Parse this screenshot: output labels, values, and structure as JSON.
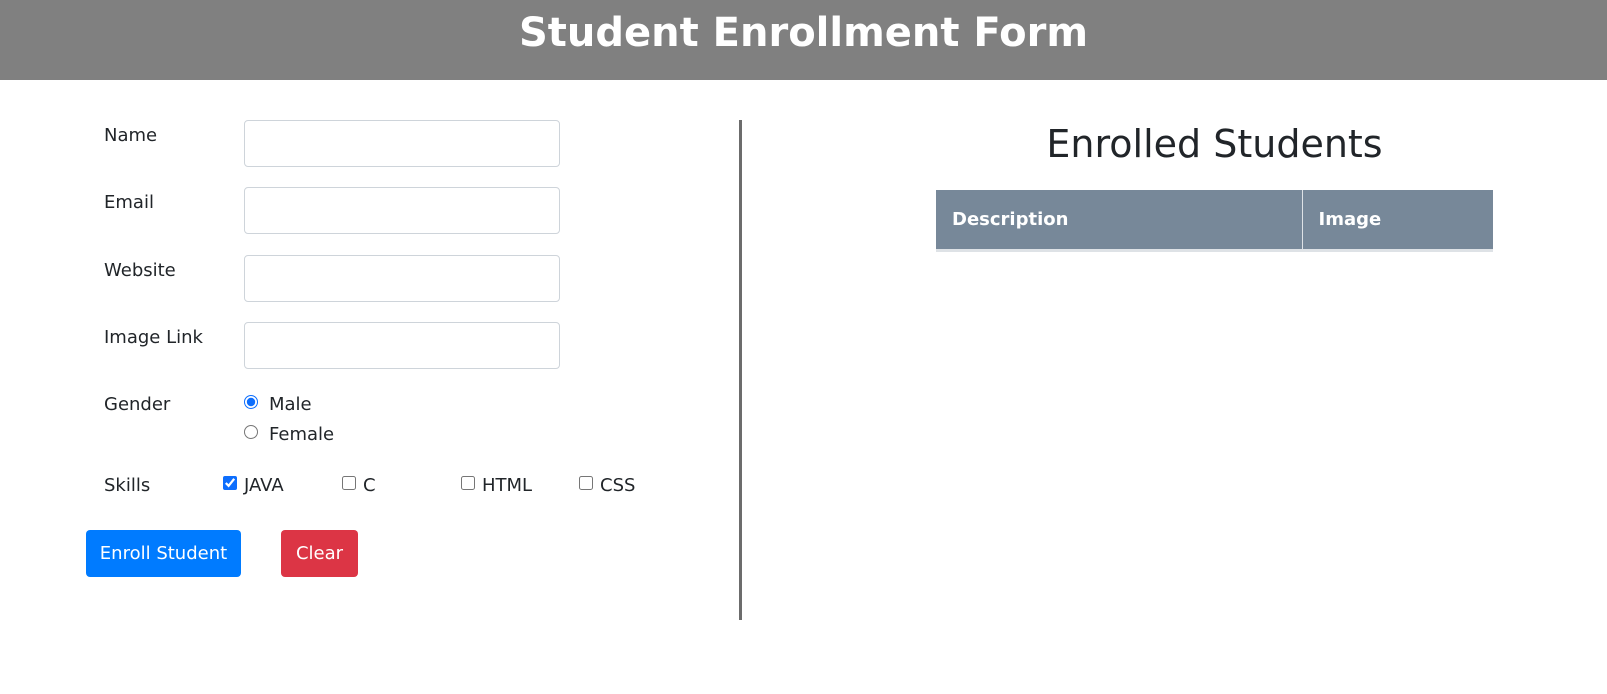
{
  "header": {
    "title": "Student Enrollment Form"
  },
  "form": {
    "fields": {
      "name": {
        "label": "Name",
        "value": "",
        "placeholder": ""
      },
      "email": {
        "label": "Email",
        "value": "",
        "placeholder": ""
      },
      "website": {
        "label": "Website",
        "value": "",
        "placeholder": ""
      },
      "image_link": {
        "label": "Image Link",
        "value": "",
        "placeholder": ""
      }
    },
    "gender": {
      "label": "Gender",
      "options": [
        {
          "label": "Male",
          "checked": true
        },
        {
          "label": "Female",
          "checked": false
        }
      ]
    },
    "skills": {
      "label": "Skills",
      "options": [
        {
          "label": "JAVA",
          "checked": true
        },
        {
          "label": "C",
          "checked": false
        },
        {
          "label": "HTML",
          "checked": false
        },
        {
          "label": "CSS",
          "checked": false
        }
      ]
    },
    "buttons": {
      "enroll_label": "Enroll Student",
      "clear_label": "Clear"
    }
  },
  "enrolled": {
    "title": "Enrolled Students",
    "columns": [
      "Description",
      "Image"
    ],
    "rows": []
  },
  "colors": {
    "header_bg": "#808080",
    "table_header_bg": "#778899",
    "primary": "#007bff",
    "danger": "#dc3545"
  }
}
